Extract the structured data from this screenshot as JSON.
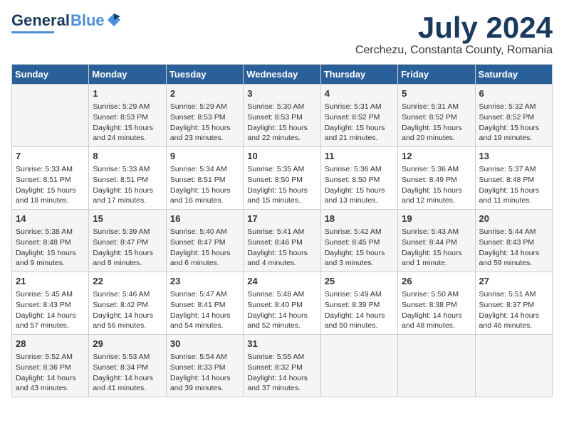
{
  "header": {
    "logo_line1": "General",
    "logo_line2": "Blue",
    "title": "July 2024",
    "subtitle": "Cerchezu, Constanta County, Romania"
  },
  "weekdays": [
    "Sunday",
    "Monday",
    "Tuesday",
    "Wednesday",
    "Thursday",
    "Friday",
    "Saturday"
  ],
  "weeks": [
    [
      {
        "day": "",
        "content": ""
      },
      {
        "day": "1",
        "content": "Sunrise: 5:29 AM\nSunset: 8:53 PM\nDaylight: 15 hours\nand 24 minutes."
      },
      {
        "day": "2",
        "content": "Sunrise: 5:29 AM\nSunset: 8:53 PM\nDaylight: 15 hours\nand 23 minutes."
      },
      {
        "day": "3",
        "content": "Sunrise: 5:30 AM\nSunset: 8:53 PM\nDaylight: 15 hours\nand 22 minutes."
      },
      {
        "day": "4",
        "content": "Sunrise: 5:31 AM\nSunset: 8:52 PM\nDaylight: 15 hours\nand 21 minutes."
      },
      {
        "day": "5",
        "content": "Sunrise: 5:31 AM\nSunset: 8:52 PM\nDaylight: 15 hours\nand 20 minutes."
      },
      {
        "day": "6",
        "content": "Sunrise: 5:32 AM\nSunset: 8:52 PM\nDaylight: 15 hours\nand 19 minutes."
      }
    ],
    [
      {
        "day": "7",
        "content": "Sunrise: 5:33 AM\nSunset: 8:51 PM\nDaylight: 15 hours\nand 18 minutes."
      },
      {
        "day": "8",
        "content": "Sunrise: 5:33 AM\nSunset: 8:51 PM\nDaylight: 15 hours\nand 17 minutes."
      },
      {
        "day": "9",
        "content": "Sunrise: 5:34 AM\nSunset: 8:51 PM\nDaylight: 15 hours\nand 16 minutes."
      },
      {
        "day": "10",
        "content": "Sunrise: 5:35 AM\nSunset: 8:50 PM\nDaylight: 15 hours\nand 15 minutes."
      },
      {
        "day": "11",
        "content": "Sunrise: 5:36 AM\nSunset: 8:50 PM\nDaylight: 15 hours\nand 13 minutes."
      },
      {
        "day": "12",
        "content": "Sunrise: 5:36 AM\nSunset: 8:49 PM\nDaylight: 15 hours\nand 12 minutes."
      },
      {
        "day": "13",
        "content": "Sunrise: 5:37 AM\nSunset: 8:48 PM\nDaylight: 15 hours\nand 11 minutes."
      }
    ],
    [
      {
        "day": "14",
        "content": "Sunrise: 5:38 AM\nSunset: 8:48 PM\nDaylight: 15 hours\nand 9 minutes."
      },
      {
        "day": "15",
        "content": "Sunrise: 5:39 AM\nSunset: 8:47 PM\nDaylight: 15 hours\nand 8 minutes."
      },
      {
        "day": "16",
        "content": "Sunrise: 5:40 AM\nSunset: 8:47 PM\nDaylight: 15 hours\nand 6 minutes."
      },
      {
        "day": "17",
        "content": "Sunrise: 5:41 AM\nSunset: 8:46 PM\nDaylight: 15 hours\nand 4 minutes."
      },
      {
        "day": "18",
        "content": "Sunrise: 5:42 AM\nSunset: 8:45 PM\nDaylight: 15 hours\nand 3 minutes."
      },
      {
        "day": "19",
        "content": "Sunrise: 5:43 AM\nSunset: 8:44 PM\nDaylight: 15 hours\nand 1 minute."
      },
      {
        "day": "20",
        "content": "Sunrise: 5:44 AM\nSunset: 8:43 PM\nDaylight: 14 hours\nand 59 minutes."
      }
    ],
    [
      {
        "day": "21",
        "content": "Sunrise: 5:45 AM\nSunset: 8:43 PM\nDaylight: 14 hours\nand 57 minutes."
      },
      {
        "day": "22",
        "content": "Sunrise: 5:46 AM\nSunset: 8:42 PM\nDaylight: 14 hours\nand 56 minutes."
      },
      {
        "day": "23",
        "content": "Sunrise: 5:47 AM\nSunset: 8:41 PM\nDaylight: 14 hours\nand 54 minutes."
      },
      {
        "day": "24",
        "content": "Sunrise: 5:48 AM\nSunset: 8:40 PM\nDaylight: 14 hours\nand 52 minutes."
      },
      {
        "day": "25",
        "content": "Sunrise: 5:49 AM\nSunset: 8:39 PM\nDaylight: 14 hours\nand 50 minutes."
      },
      {
        "day": "26",
        "content": "Sunrise: 5:50 AM\nSunset: 8:38 PM\nDaylight: 14 hours\nand 48 minutes."
      },
      {
        "day": "27",
        "content": "Sunrise: 5:51 AM\nSunset: 8:37 PM\nDaylight: 14 hours\nand 46 minutes."
      }
    ],
    [
      {
        "day": "28",
        "content": "Sunrise: 5:52 AM\nSunset: 8:36 PM\nDaylight: 14 hours\nand 43 minutes."
      },
      {
        "day": "29",
        "content": "Sunrise: 5:53 AM\nSunset: 8:34 PM\nDaylight: 14 hours\nand 41 minutes."
      },
      {
        "day": "30",
        "content": "Sunrise: 5:54 AM\nSunset: 8:33 PM\nDaylight: 14 hours\nand 39 minutes."
      },
      {
        "day": "31",
        "content": "Sunrise: 5:55 AM\nSunset: 8:32 PM\nDaylight: 14 hours\nand 37 minutes."
      },
      {
        "day": "",
        "content": ""
      },
      {
        "day": "",
        "content": ""
      },
      {
        "day": "",
        "content": ""
      }
    ]
  ]
}
